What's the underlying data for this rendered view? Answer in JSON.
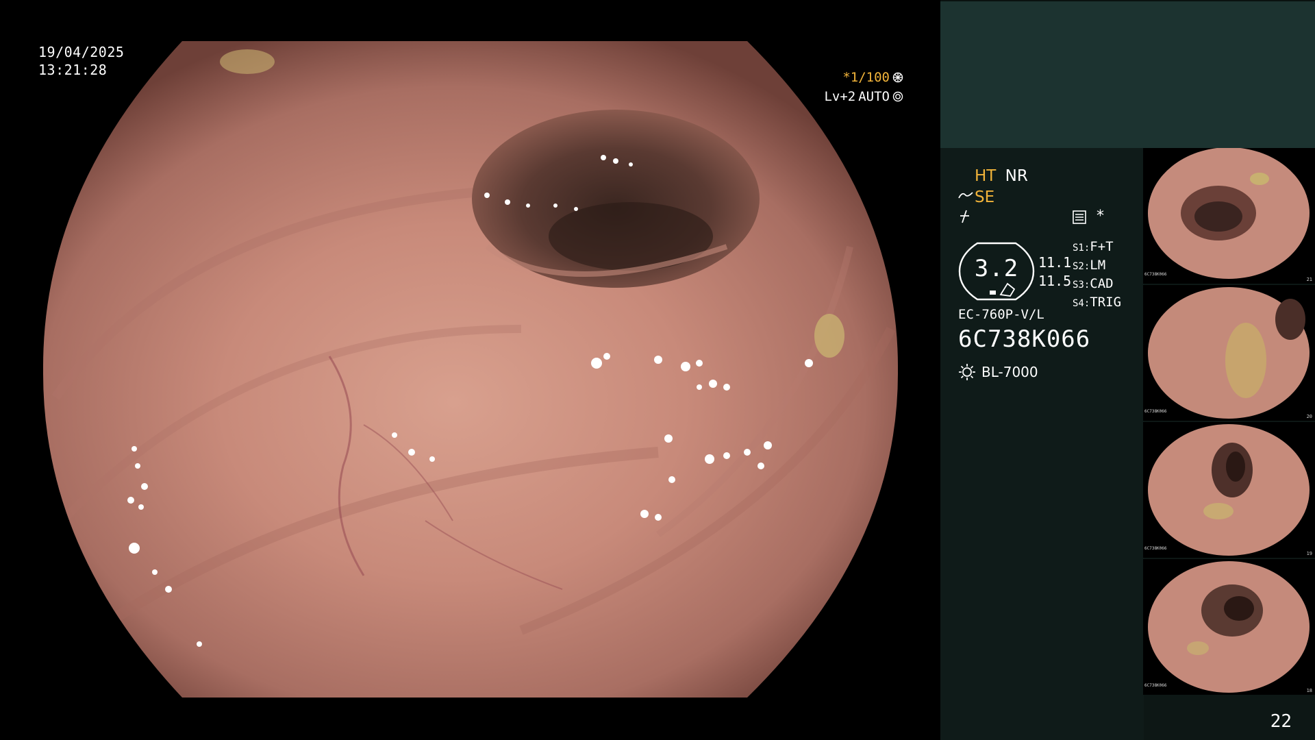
{
  "live_view": {
    "date": "19/04/2025",
    "time": "13:21:28",
    "shutter": "*1/100",
    "brightness": "Lv+2",
    "iris": "AUTO"
  },
  "panel": {
    "mode_ht": "HT",
    "mode_nr": "NR",
    "mode_se": "SE",
    "star": "*",
    "zoom": "3.2",
    "zoom_sub_1": "11.1",
    "zoom_sub_2": "11.5",
    "switches": [
      {
        "key": "S1",
        "value": "F+T"
      },
      {
        "key": "S2",
        "value": "LM"
      },
      {
        "key": "S3",
        "value": "CAD"
      },
      {
        "key": "S4",
        "value": "TRIG"
      }
    ],
    "scope_model": "EC-760P-V/L",
    "scope_serial": "6C738K066",
    "light_source": "BL-7000",
    "page_number": "22"
  },
  "thumbnails": [
    {
      "index": "21",
      "serial": "6C738K066"
    },
    {
      "index": "20",
      "serial": "6C738K066"
    },
    {
      "index": "19",
      "serial": "6C738K066"
    },
    {
      "index": "18",
      "serial": "6C738K066"
    }
  ],
  "colors": {
    "accent_yellow": "#f2b43a",
    "panel_top": "#1c3330",
    "panel_bg": "#0f1b19",
    "mucosa": "#c98a7c"
  },
  "icons": [
    "shutter-icon",
    "iris-icon",
    "structure-enhance-icon",
    "color-curve-icon",
    "settings-icon",
    "light-source-icon",
    "zoom-badge-icon"
  ]
}
